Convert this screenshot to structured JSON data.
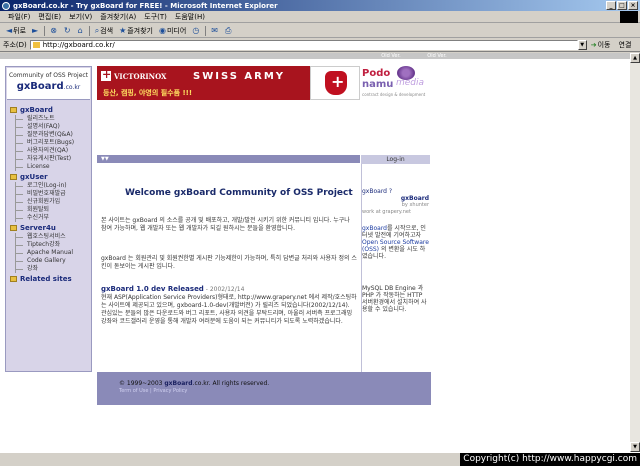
{
  "window": {
    "title": "gxBoard.co.kr - Try gxBoard for FREE! - Microsoft Internet Explorer",
    "controls": [
      "_",
      "□",
      "×"
    ]
  },
  "menubar": [
    "파일(F)",
    "편집(E)",
    "보기(V)",
    "즐겨찾기(A)",
    "도구(T)",
    "도움말(H)"
  ],
  "toolbar": {
    "back": "뒤로",
    "search": "검색",
    "favorites": "즐겨찾기",
    "media": "미디어"
  },
  "address": {
    "label": "주소(D)",
    "url": "http://gxboard.co.kr/",
    "go": "이동",
    "links": "연결"
  },
  "page": {
    "sidebar": {
      "subtitle": "Community of OSS Project",
      "brand": "gxBoard",
      "brand_domain": ".co.kr",
      "categories": [
        {
          "title": "gxBoard",
          "items": [
            "릴리즈노트",
            "설명서(FAQ)",
            "질문과답변(Q&A)",
            "버그리포트(Bugs)",
            "사용자의견(QA)",
            "자유게시판(Test)",
            "License"
          ]
        },
        {
          "title": "gxUser",
          "items": [
            "로그인(Log-in)",
            "비밀번호재발급",
            "신규회원가입",
            "회원탈퇴",
            "수신거부"
          ]
        },
        {
          "title": "Server4u",
          "items": [
            "웹호스팅서비스",
            "Tiptech강좌",
            "Apache Manual",
            "Code Gallery",
            "강좌"
          ]
        },
        {
          "title": "Related sites",
          "items": []
        }
      ]
    },
    "banner": {
      "brand": "VICTORINOX",
      "swiss": "SWISS ARMY",
      "tagline": "등산, 캠핑, 야영의 필수품 !!!",
      "podo": "Podo",
      "namu": "namu",
      "media": "media",
      "podo_tag": "contract design & development"
    },
    "login_label": "Log-in",
    "welcome": "Welcome gxBoard Community of OSS Project",
    "intro": "본 사이트는 gxBoard 의 소스를 공개 및 배포하고, 개발/발전 시키기 위한 커뮤니티 입니다. 누구나 참여 가능하며, 웹 개발자 또는 웹 개발자가 되길 원하시는 분들을 환영합니다.",
    "intro2": "gxBoard 는 회원관리 및 회원권한별 게시판 기능제한이 가능하며, 특히 답변글 처리와 사용자 정의 스킨이 돋보이는 게시판 입니다.",
    "news": {
      "title": "gxBoard 1.0 dev Released",
      "date": "- 2002/12/14",
      "body": "현재 ASP(Application Service Providers)형태로, http://www.grapery.net 에서 제작/호스팅하는 사이트에 제공되고 있으며, gxboard-1.0-dev(개발버전) 가 릴리즈 되었습니다(2002/12/14). 관심있는 분들의 많은 다운로드와 버그 리포트, 사용자 의견을 부탁드리며, 아울러 서버측 프로그래밍 강좌와 코드갤러리 운영을 통해 개발자 여러분에 도움이 되는 커뮤니티가 되도록 노력하겠습니다."
    },
    "right": {
      "head": "gxBoard ?",
      "gx_logo": "gxBoard",
      "by": "by xhunter",
      "work": "work at grapery.net",
      "desc_a": "gxBoard",
      "desc_b": "를 시작으로, 인터넷 발전에 기여하고자 ",
      "desc_link": "Open Source Software (OSS)",
      "desc_c": " 의 변환을 시도 하였습니다.",
      "req": "MySQL DB Engine 과 PHP 가 작동하는 HTTP 서버환경에서 설치하여 사용할 수 있습니다."
    },
    "footer": {
      "copy_pre": "© 1999~2003 ",
      "copy_brand": "gxBoard",
      "copy_post": ".co.kr. All rights reserved.",
      "links": "Term of Use | Privacy Policy"
    },
    "topstrip": {
      "cell1": "Old Ver.",
      "cell2": "Old Ver."
    }
  },
  "watermark": "Copyright(c) http://www.happycgi.com"
}
